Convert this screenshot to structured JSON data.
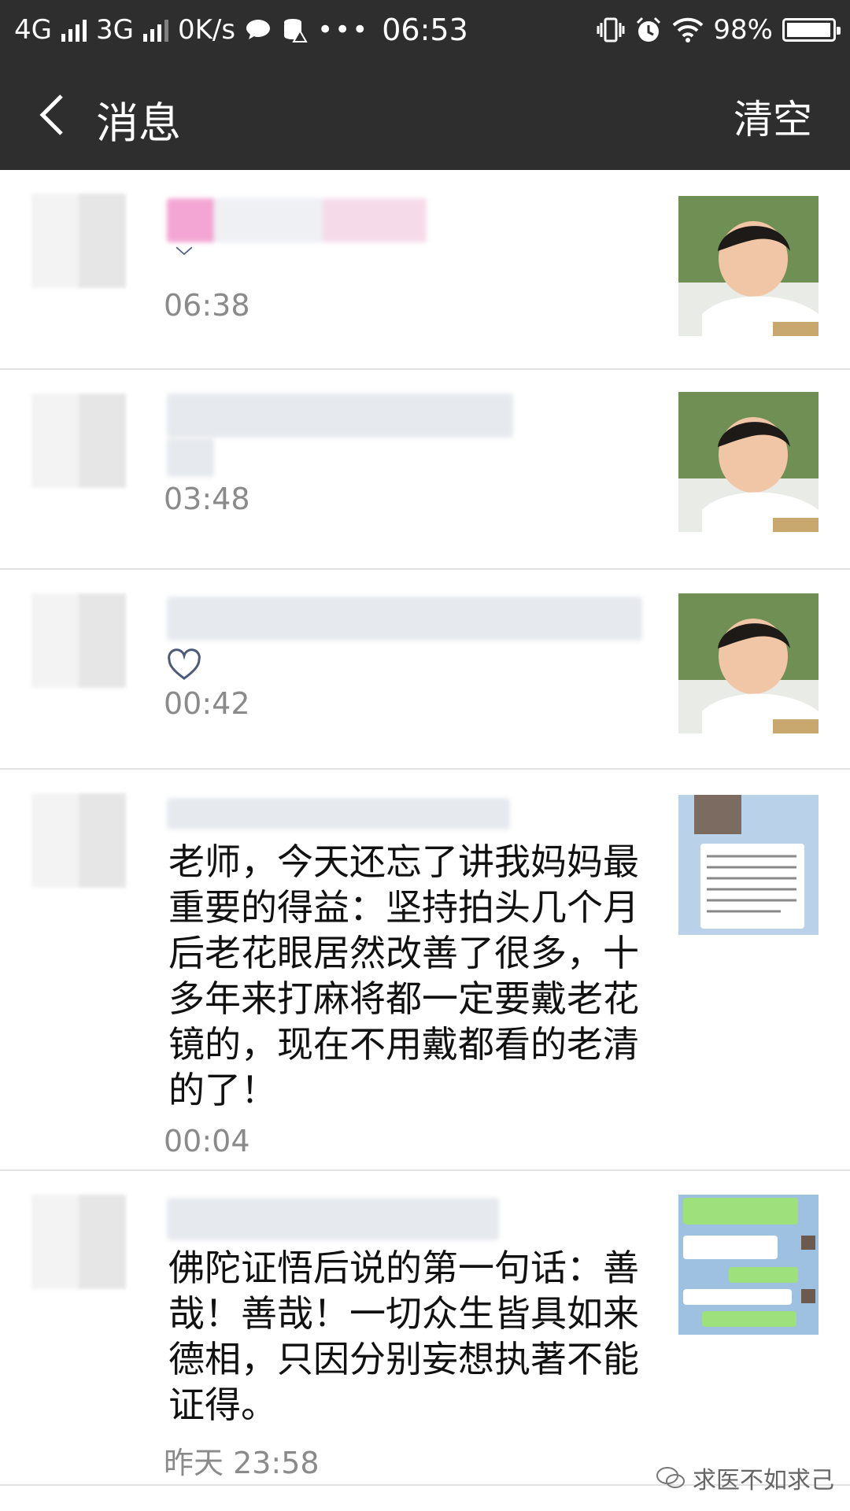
{
  "status_bar": {
    "network1": "4G",
    "network2": "3G",
    "speed": "0K/s",
    "time": "06:53",
    "battery": "98%",
    "battery_level": 0.98
  },
  "header": {
    "title": "消息",
    "action": "清空"
  },
  "messages": [
    {
      "time": "06:38",
      "content": ""
    },
    {
      "time": "03:48",
      "content": ""
    },
    {
      "time": "00:42",
      "content": ""
    },
    {
      "time": "00:04",
      "content": "老师，今天还忘了讲我妈妈最重要的得益：坚持拍头几个月后老花眼居然改善了很多，十多年来打麻将都一定要戴老花镜的，现在不用戴都看的老清的了！"
    },
    {
      "time": "昨天 23:58",
      "content": "佛陀证悟后说的第一句话：善哉！善哉！一切众生皆具如来德相，只因分别妄想执著不能证得。"
    }
  ],
  "watermark": "求医不如求己"
}
